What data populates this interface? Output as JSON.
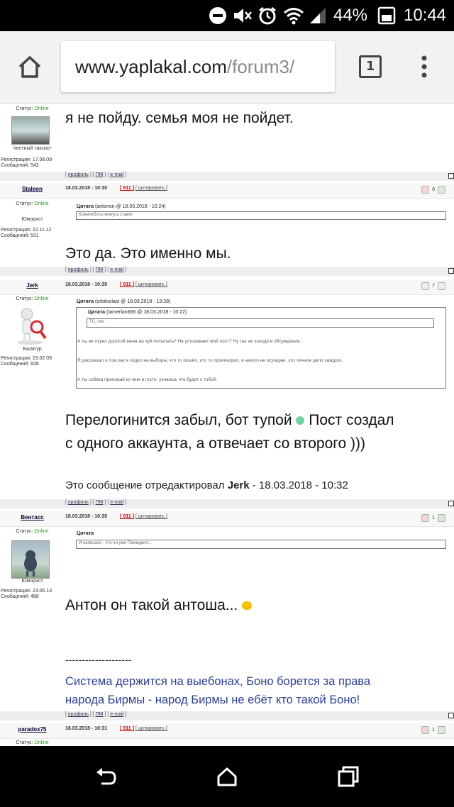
{
  "status_bar": {
    "battery_percent": "44%",
    "time": "10:44"
  },
  "browser": {
    "url_host": "www.yaplakal.com",
    "url_path": "/forum3/",
    "tab_count": "1"
  },
  "posts": [
    {
      "status_label": "Статус: ",
      "status_value": "Online",
      "rank": "Честный таксист",
      "reg": "Регистрация: 17.08.09",
      "msgs": "Сообщений: 542",
      "body": "я не пойду. семья моя не пойдет.",
      "footer": {
        "profile": "профиль",
        "pm": "ПМ",
        "email": "e-mail"
      }
    },
    {
      "user": "Staleon",
      "datetime": "18.03.2018 - 10:30",
      "num": "911",
      "cite": "цитировать",
      "rating": "0",
      "status_label": "Статус: ",
      "status_value": "Online",
      "rank": "Юморист",
      "reg": "Регистрация: 22.11.12",
      "msgs": "Сообщений: 531",
      "quote_header_bold": "Цитата",
      "quote_header_rest": " (antonon @ 18.03.2018 - 10:24)",
      "quote_text": "Кремлеботы минуса ставят",
      "body": "Это да. Это именно мы.",
      "footer": {
        "profile": "профиль",
        "pm": "ПМ",
        "email": "e-mail"
      }
    },
    {
      "user": "Jerk",
      "datetime": "18.03.2018 - 10:30",
      "num": "911",
      "cite": "цитировать",
      "rating": "7",
      "status_label": "Статус: ",
      "status_value": "Online",
      "rank": "Балагур",
      "reg": "Регистрация: 23.02.09",
      "msgs": "Сообщений: 828",
      "quote_header_bold": "Цитата",
      "quote_header_rest": " (orbitoclast @ 18.03.2018 - 13:28)",
      "inner_quote_bold": "Цитата",
      "inner_quote_rest": " (tamerlan666 @ 18.03.2018 - 10:22)",
      "inner_quote_text": "ТС, пнх",
      "quote_lines": [
        "А ты не охуел дорогой меня на хуй посылать? Не устраивает мой пост? Ну так не заходи в обсуждения.",
        "Я рассказал о том как я ходил на выборы, кто то пошёл, кто то проигнорил, я никого не осуждаю, это личное дело каждого.",
        "А ты собака приезжай ко мне в гости, узнаешь что будет с тобой."
      ],
      "body_line1a": "Перелогинится забыл, бот тупой ",
      "body_line1b": " Пост создал",
      "body_line2": "с одного аккаунта, а отвечает со второго )))",
      "edit_prefix": "Это сообщение отредактировал ",
      "edit_user": "Jerk",
      "edit_suffix": " - 18.03.2018 - 10:32",
      "footer": {
        "profile": "профиль",
        "pm": "ПМ",
        "email": "e-mail"
      }
    },
    {
      "user": "Вентасс",
      "datetime": "18.03.2018 - 10:30",
      "num": "911",
      "cite": "цитировать",
      "rating": "1",
      "status_label": "Статус: ",
      "status_value": "Online",
      "rank": "Юморист",
      "reg": "Регистрация: 23.05.13",
      "msgs": "Сообщений: 486",
      "quote_header_bold": "Цитата",
      "quote_text": "И написали , что он уже Президент...",
      "body": "Антон он такой антоша...",
      "sig_dashes": "--------------------",
      "sig_line1": "Система держится на выебонах, Боно борется за права",
      "sig_line2": "народа Бирмы - народ Бирмы не ебёт кто такой Боно!",
      "footer": {
        "profile": "профиль",
        "pm": "ПМ",
        "email": "e-mail"
      }
    },
    {
      "user": "paradox75",
      "datetime": "18.03.2018 - 10:31",
      "num": "911",
      "cite": "цитировать",
      "rating": "1",
      "status_label": "Статус: ",
      "status_value": "Online"
    }
  ],
  "colors": {
    "online": "#2c9a2c",
    "signature": "#2d3f8f",
    "post_number": "#cc0000"
  }
}
